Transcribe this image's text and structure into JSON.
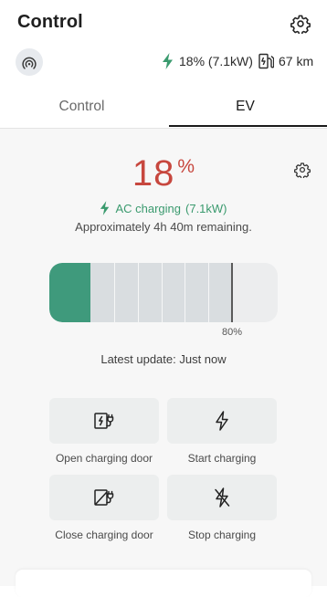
{
  "header": {
    "title": "Control",
    "settings_icon": "gear-icon",
    "connection_icon": "signal-icon",
    "charge_status": "18% (7.1kW)",
    "range": "67 km"
  },
  "tabs": [
    {
      "label": "Control",
      "active": false
    },
    {
      "label": "EV",
      "active": true
    }
  ],
  "ev": {
    "soc_value": "18",
    "soc_unit": "%",
    "charging_text": "AC charging",
    "charging_power": "(7.1kW)",
    "remaining_text": "Approximately 4h 40m remaining.",
    "battery_level": 0.18,
    "charge_limit": 0.8,
    "charge_limit_label": "80%",
    "latest_update": "Latest update: Just now"
  },
  "actions": [
    {
      "label": "Open charging door",
      "icon": "open-charging-door-icon"
    },
    {
      "label": "Start charging",
      "icon": "lightning-icon"
    },
    {
      "label": "Close charging door",
      "icon": "close-charging-door-icon"
    },
    {
      "label": "Stop charging",
      "icon": "lightning-off-icon"
    }
  ],
  "colors": {
    "accent_green": "#3f9a7c",
    "soc_red": "#c7473e",
    "tab_active": "#1a1a1a"
  }
}
